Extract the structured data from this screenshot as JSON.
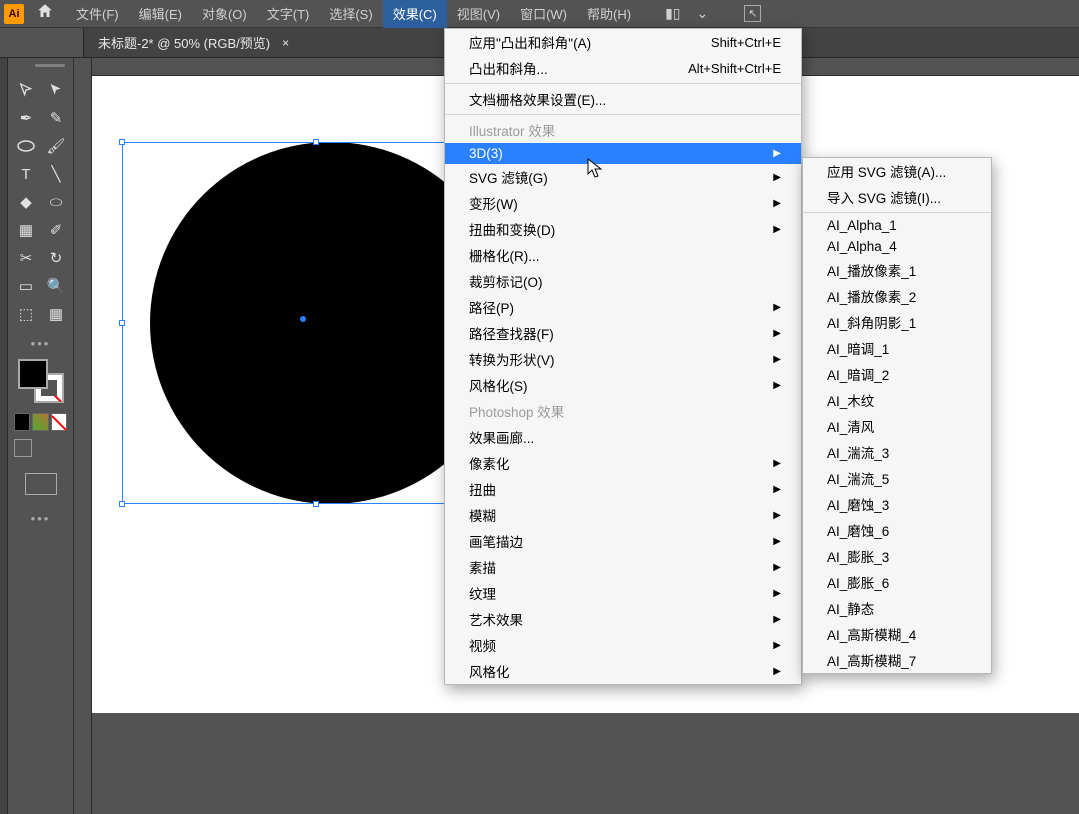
{
  "app": {
    "icon_text": "Ai"
  },
  "menubar": {
    "items": [
      "文件(F)",
      "编辑(E)",
      "对象(O)",
      "文字(T)",
      "选择(S)",
      "效果(C)",
      "视图(V)",
      "窗口(W)",
      "帮助(H)"
    ]
  },
  "tab": {
    "title": "未标题-2* @ 50% (RGB/预览)",
    "close": "×"
  },
  "effects_menu": {
    "apply_last": {
      "label": "应用\"凸出和斜角\"(A)",
      "shortcut": "Shift+Ctrl+E"
    },
    "last": {
      "label": "凸出和斜角...",
      "shortcut": "Alt+Shift+Ctrl+E"
    },
    "doc_raster": {
      "label": "文档栅格效果设置(E)..."
    },
    "section_ai": "Illustrator 效果",
    "items_ai": [
      {
        "label": "3D(3)",
        "sub": true,
        "hl": true
      },
      {
        "label": "SVG 滤镜(G)",
        "sub": true
      },
      {
        "label": "变形(W)",
        "sub": true
      },
      {
        "label": "扭曲和变换(D)",
        "sub": true
      },
      {
        "label": "栅格化(R)..."
      },
      {
        "label": "裁剪标记(O)"
      },
      {
        "label": "路径(P)",
        "sub": true
      },
      {
        "label": "路径查找器(F)",
        "sub": true
      },
      {
        "label": "转换为形状(V)",
        "sub": true
      },
      {
        "label": "风格化(S)",
        "sub": true
      }
    ],
    "section_ps": "Photoshop 效果",
    "items_ps": [
      {
        "label": "效果画廊..."
      },
      {
        "label": "像素化",
        "sub": true
      },
      {
        "label": "扭曲",
        "sub": true
      },
      {
        "label": "模糊",
        "sub": true
      },
      {
        "label": "画笔描边",
        "sub": true
      },
      {
        "label": "素描",
        "sub": true
      },
      {
        "label": "纹理",
        "sub": true
      },
      {
        "label": "艺术效果",
        "sub": true
      },
      {
        "label": "视频",
        "sub": true
      },
      {
        "label": "风格化",
        "sub": true
      }
    ]
  },
  "svg_submenu": {
    "top": [
      {
        "label": "应用 SVG 滤镜(A)..."
      },
      {
        "label": "导入 SVG 滤镜(I)..."
      }
    ],
    "items": [
      "AI_Alpha_1",
      "AI_Alpha_4",
      "AI_播放像素_1",
      "AI_播放像素_2",
      "AI_斜角阴影_1",
      "AI_暗调_1",
      "AI_暗调_2",
      "AI_木纹",
      "AI_清风",
      "AI_湍流_3",
      "AI_湍流_5",
      "AI_磨蚀_3",
      "AI_磨蚀_6",
      "AI_膨胀_3",
      "AI_膨胀_6",
      "AI_静态",
      "AI_高斯模糊_4",
      "AI_高斯模糊_7"
    ]
  }
}
